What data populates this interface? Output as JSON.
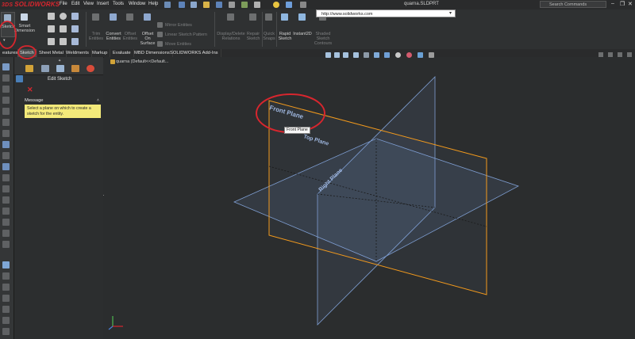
{
  "app": {
    "brand": "SOLIDWORKS",
    "brand_mark": "3DS",
    "document_title": "quarna.SLDPRT"
  },
  "menu": [
    "File",
    "Edit",
    "View",
    "Insert",
    "Tools",
    "Window",
    "Help"
  ],
  "url_bar": {
    "value": "http://www.solidworks.com"
  },
  "search": {
    "placeholder": "Search Commands"
  },
  "window_controls": {
    "minimize": "–",
    "restore": "❐",
    "close": "✕"
  },
  "ribbon": {
    "sketch": "Sketch",
    "smart_dimension": [
      "Smart",
      "Dimension"
    ],
    "trim_entities": [
      "Trim",
      "Entities"
    ],
    "convert_entities": [
      "Convert",
      "Entities"
    ],
    "offset_entities": [
      "Offset",
      "Entities"
    ],
    "offset_on_surface": [
      "Offset",
      "On",
      "Surface"
    ],
    "mirror_entities": "Mirror Entities",
    "linear_sketch_pattern": "Linear Sketch Pattern",
    "move_entities": "Move Entities",
    "display_delete_relations": [
      "Display/Delete",
      "Relations"
    ],
    "repair_sketch": [
      "Repair",
      "Sketch"
    ],
    "quick_snaps": [
      "Quick",
      "Snaps"
    ],
    "rapid_sketch": [
      "Rapid",
      "Sketch"
    ],
    "instant2d": "Instant2D",
    "shaded_sketch_contours": [
      "Shaded",
      "Sketch",
      "Contours"
    ]
  },
  "tabs": [
    "Features",
    "Sketch",
    "Sheet Metal",
    "Weldments",
    "Markup",
    "Evaluate",
    "MBD Dimensions",
    "SOLIDWORKS Add-Ins"
  ],
  "tabs_display": [
    "eatures",
    "Sketch",
    "Sheet Metal",
    "Weldments",
    "Markup",
    "Evaluate",
    "MBD Dimensions",
    "SOLIDWORKS Add-Ins"
  ],
  "active_tab": "Sketch",
  "property_manager": {
    "title": "Edit Sketch",
    "message_header": "Message",
    "message_text": "Select a plane on which to create a sketch for the entity."
  },
  "viewport": {
    "breadcrumb": "quarna (Default<<Default...",
    "planes": [
      "Front Plane",
      "Top Plane",
      "Right Plane"
    ],
    "tooltip": "Front Plane",
    "colors": {
      "highlight_plane": "#f39a1c",
      "plane": "#7f9fd3",
      "annotation": "#d8262e",
      "background": "#2b2d2e"
    }
  },
  "annotation_circles": 3,
  "icons": [
    "solidworks-logo",
    "home-icon",
    "new-doc-icon",
    "open-icon",
    "save-icon",
    "print-icon",
    "undo-icon",
    "select-icon",
    "rebuild-icon",
    "options-icon",
    "search-icon",
    "sketch-icon",
    "smart-dimension-icon",
    "line-icon",
    "rectangle-icon",
    "circle-icon",
    "arc-icon",
    "spline-icon",
    "trim-icon",
    "convert-icon",
    "offset-icon",
    "mirror-icon",
    "pattern-icon",
    "move-icon",
    "relations-icon",
    "repair-icon",
    "snaps-icon",
    "rapid-sketch-icon",
    "instant2d-icon",
    "shaded-contours-icon",
    "zoom-fit-icon",
    "zoom-area-icon",
    "previous-view-icon",
    "section-view-icon",
    "view-orientation-icon",
    "display-style-icon",
    "hide-show-icon",
    "appearance-icon",
    "scene-icon",
    "view-settings-icon",
    "triad-icon"
  ]
}
